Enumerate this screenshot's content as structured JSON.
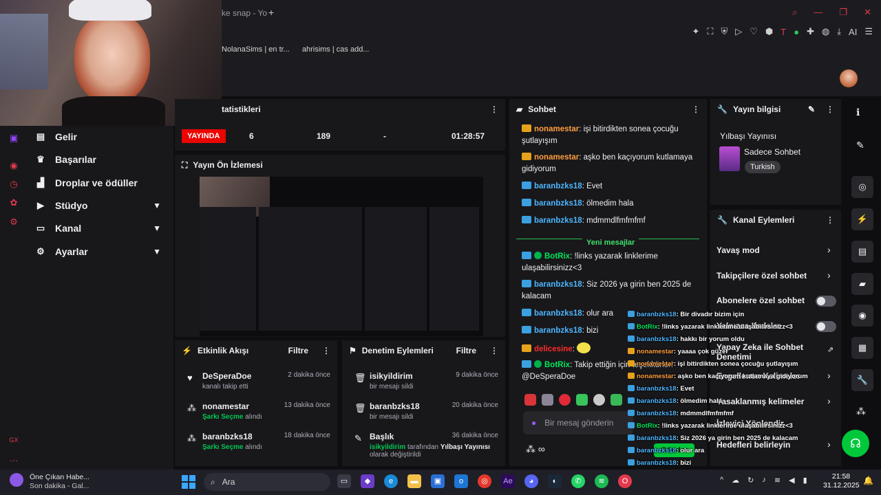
{
  "browser": {
    "tab_title": "ke snap - Yo",
    "new_tab": "+",
    "bookmarks": [
      "NolanaSims | en tr...",
      "ahrisims | cas add..."
    ],
    "page_title": "tatistikleri",
    "toolbar_ai": "AI"
  },
  "sidebar": {
    "items": [
      {
        "label": "Gelir",
        "icon": "chart-icon"
      },
      {
        "label": "Başarılar",
        "icon": "trophy-icon"
      },
      {
        "label": "Droplar ve ödüller",
        "icon": "gift-icon"
      },
      {
        "label": "Stüdyo",
        "icon": "video-icon"
      },
      {
        "label": "Kanal",
        "icon": "tv-icon"
      },
      {
        "label": "Ayarlar",
        "icon": "gear-icon"
      }
    ],
    "gx_label": "GX"
  },
  "stats": {
    "live": "YAYINDA",
    "viewers": "6",
    "followers": "189",
    "dash": "-",
    "uptime": "01:28:57"
  },
  "preview": {
    "title": "Yayın Ön İzlemesi"
  },
  "activity": {
    "title": "Etkinlik Akışı",
    "filter": "Filtre",
    "items": [
      {
        "who": "DeSperaDoe",
        "sub_pre": "kanalı takip etti",
        "sub_bold": "",
        "sub_post": "",
        "time": "2 dakika önce",
        "icon": "heart-icon"
      },
      {
        "who": "nonamestar",
        "sub_pre": "",
        "sub_bold": "Şarkı Seçme",
        "sub_post": " alındı",
        "time": "13 dakika önce",
        "icon": "points-icon"
      },
      {
        "who": "baranbzks18",
        "sub_pre": "",
        "sub_bold": "Şarkı Seçme",
        "sub_post": " alındı",
        "time": "18 dakika önce",
        "icon": "points-icon"
      }
    ]
  },
  "moderation": {
    "title": "Denetim Eylemleri",
    "filter": "Filtre",
    "items": [
      {
        "who": "isikyildirim",
        "sub": "bir mesajı sildi",
        "time": "9 dakika önce"
      },
      {
        "who": "baranbzks18",
        "sub": "bir mesajı sildi",
        "time": "20 dakika önce"
      },
      {
        "who": "Başlık",
        "sub_user": "isikyildirim",
        "sub_mid": " tarafından ",
        "sub_bold": "Yılbaşı Yayınısı",
        "sub_end": "olarak değiştirildi",
        "time": "36 dakika önce"
      }
    ]
  },
  "chat": {
    "title": "Sohbet",
    "messages": [
      {
        "user": "nonamestar",
        "color": "orange",
        "text": ": işi bitirdikten sonea çocuğu şutlayışım"
      },
      {
        "user": "nonamestar",
        "color": "orange",
        "text": ": aşko ben kaçıyorum kutlamaya gidiyorum"
      },
      {
        "user": "baranbzks18",
        "color": "blue",
        "text": ": Evet"
      },
      {
        "user": "baranbzks18",
        "color": "blue",
        "text": ": ölmedim hala"
      },
      {
        "user": "baranbzks18",
        "color": "blue",
        "text": ": mdmmdlfmfmfmf"
      },
      {
        "user": "BotRix",
        "color": "green",
        "text": ": !links yazarak linklerime ulaşabilirsinizz<3"
      },
      {
        "user": "baranbzks18",
        "color": "blue",
        "text": ": Siz 2026 ya girin ben 2025 de kalacam"
      },
      {
        "user": "baranbzks18",
        "color": "blue",
        "text": ": olur ara"
      },
      {
        "user": "baranbzks18",
        "color": "blue",
        "text": ": bizi"
      },
      {
        "user": "delicesine",
        "color": "red",
        "text": ":"
      },
      {
        "user": "BotRix",
        "color": "green",
        "text": ": Takip ettiğin için teşekkürler! @DeSperaDoe"
      }
    ],
    "new_messages": "Yeni mesajlar",
    "input_placeholder": "Bir mesaj gönderin",
    "send": "Gönder"
  },
  "overlay_chat": [
    {
      "user": "baranbzks18",
      "text": ": Bir divadır bizim için"
    },
    {
      "user": "BotRix",
      "text": ": !links yazarak linklerime ulaşabilirsinizz<3"
    },
    {
      "user": "baranbzks18",
      "text": ": hakkı bir yorum oldu"
    },
    {
      "user": "nonamestar",
      "text": ": yaaaa çok güzel"
    },
    {
      "user": "nonamestar",
      "text": ": işi bitirdikten sonea çocuğu şutlayışım"
    },
    {
      "user": "nonamestar",
      "text": ": aşko ben kaçıyorum kutlamaya gidiyorum"
    },
    {
      "user": "baranbzks18",
      "text": ": Evet"
    },
    {
      "user": "baranbzks18",
      "text": ": ölmedim hala"
    },
    {
      "user": "baranbzks18",
      "text": ": mdmmdlfmfmfmf"
    },
    {
      "user": "BotRix",
      "text": ": !links yazarak linklerime ulaşabilirsinizz<3"
    },
    {
      "user": "baranbzks18",
      "text": ": Siz 2026 ya girin ben 2025 de kalacam"
    },
    {
      "user": "baranbzks18",
      "text": ": olur ara"
    },
    {
      "user": "baranbzks18",
      "text": ": bizi"
    },
    {
      "user": "delicesine",
      "text": ":"
    },
    {
      "user": "BotRix",
      "text": ": Takip ettiğin için teşekkürler! @DeSperaDoe"
    }
  ],
  "stream_info": {
    "title": "Yayın bilgisi",
    "stream_title": "Yılbaşı Yayınısı",
    "category": "Sadece Sohbet",
    "language": "Turkish"
  },
  "channel_actions": {
    "title": "Kanal Eylemleri",
    "items": [
      "Yavaş mod",
      "Takipçilere özel sohbet",
      "Abonelere özel sohbet",
      "Yalnızca Ifadeler",
      "Yapay Zeka ile Sohbet Denetimi",
      "Engellenen Kelimeler",
      "Yasaklanmış kelimeler",
      "İzleyici Yönlendir",
      "Hedefleri belirleyin"
    ]
  },
  "taskbar": {
    "news_title": "Öne Çıkan Habe...",
    "news_sub": "Son dakika - Gal...",
    "search": "Ara",
    "time": "21:58",
    "date": "31.12.2025"
  },
  "colors": {
    "accent_green": "#00c83a",
    "live_red": "#eb0400",
    "panel_bg": "#18181b"
  }
}
